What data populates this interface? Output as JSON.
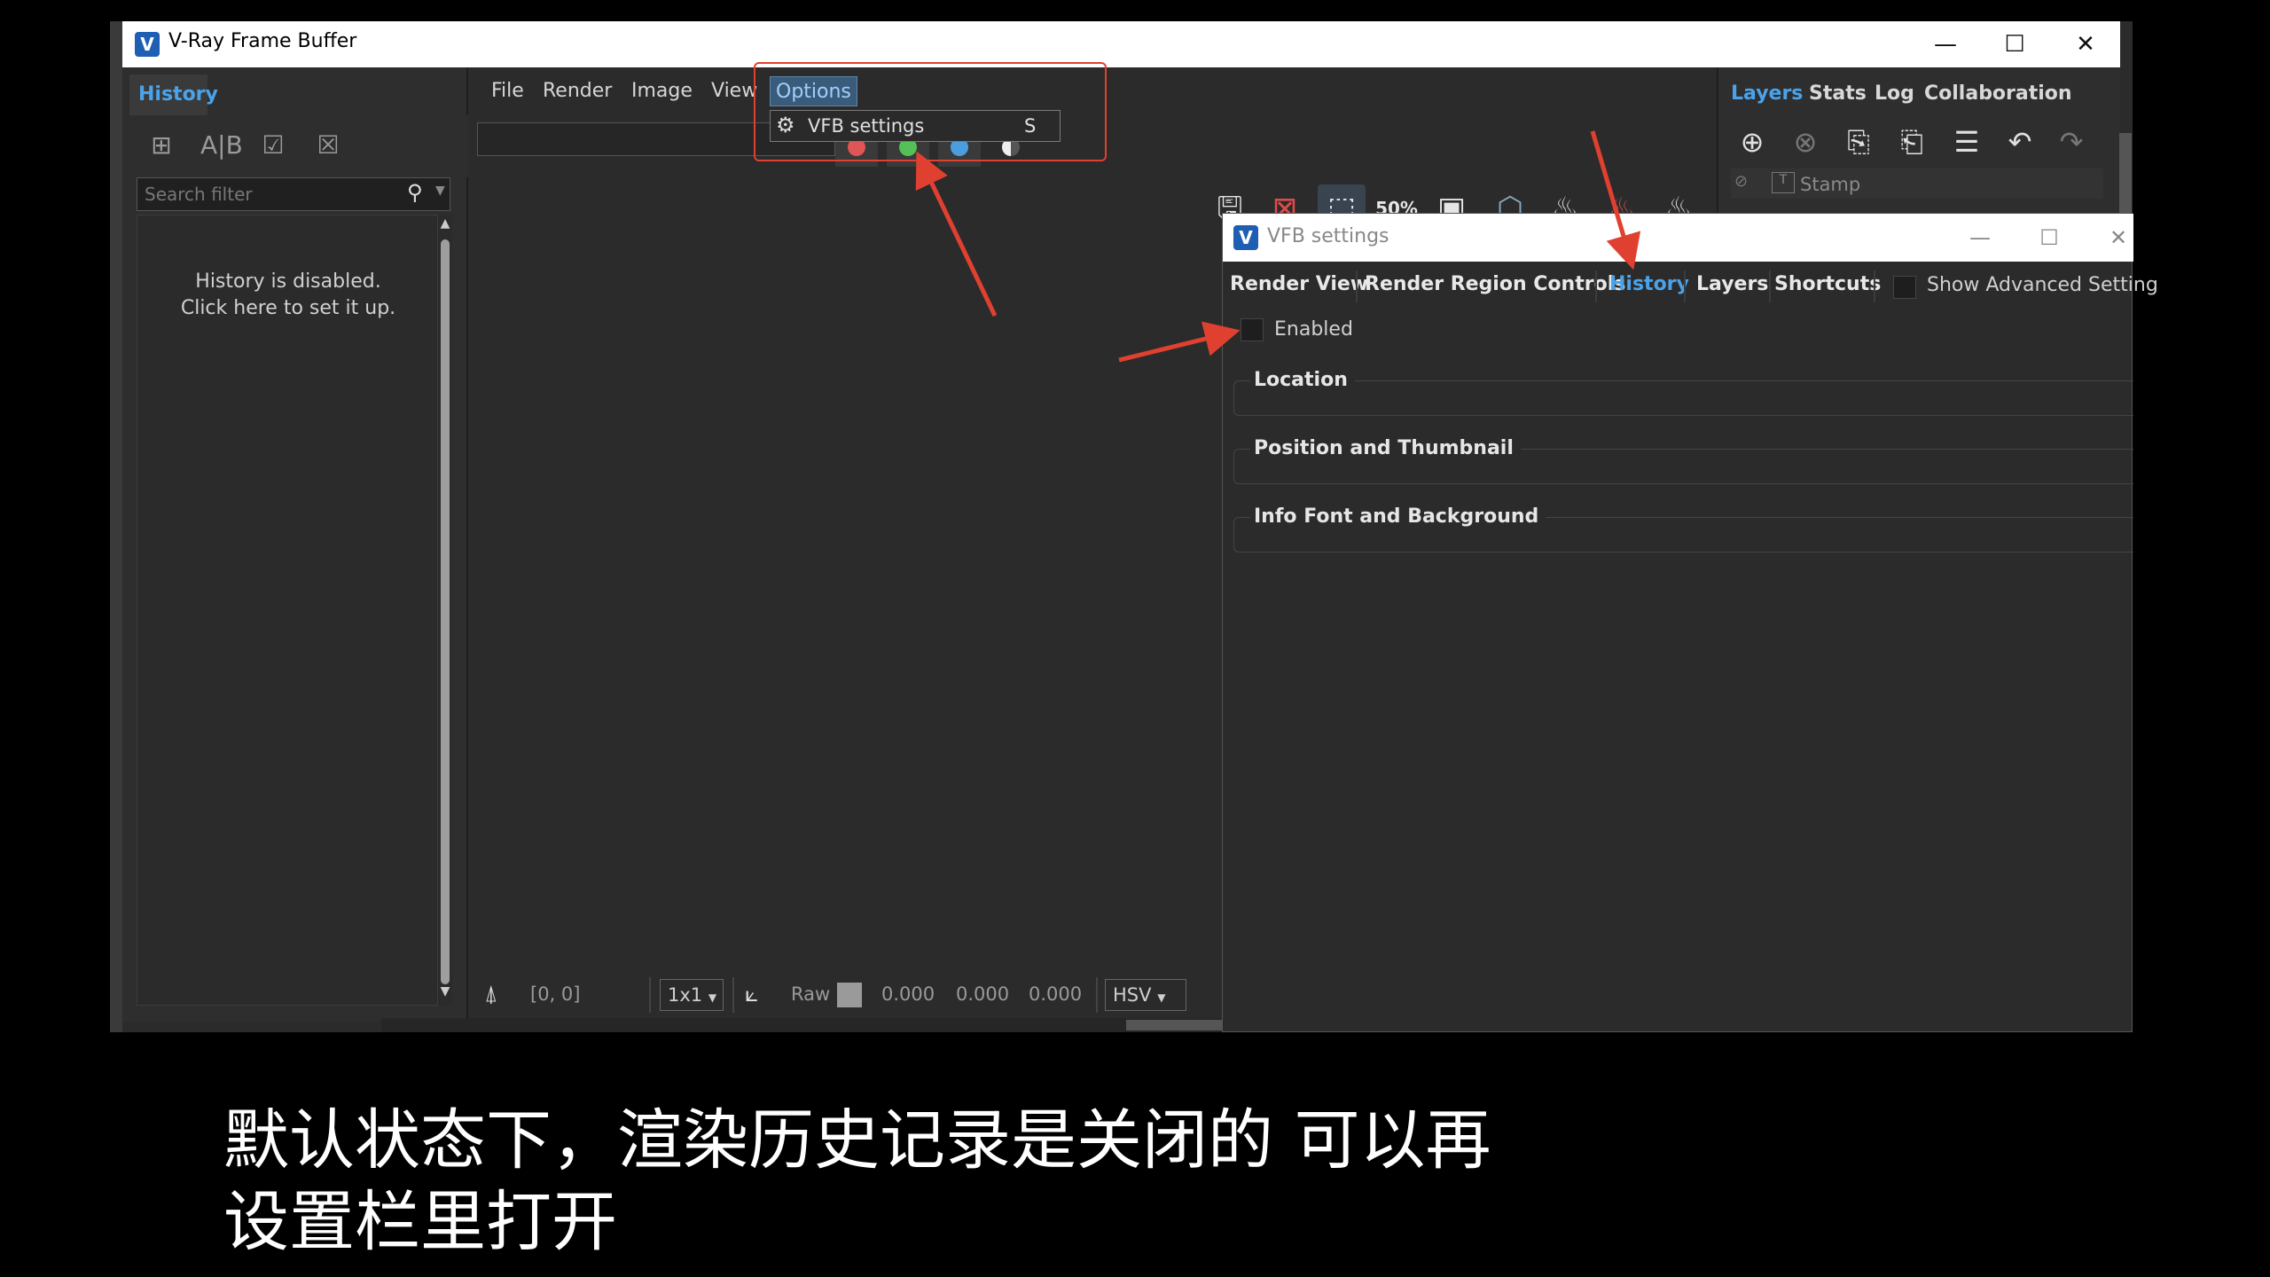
{
  "window": {
    "title": "V-Ray Frame Buffer",
    "app_icon": "vray-logo-icon",
    "minimize": "—",
    "maximize": "☐",
    "close": "✕"
  },
  "history_panel": {
    "tab": "History",
    "search_placeholder": "Search filter",
    "message_line1": "History is disabled.",
    "message_line2": "Click here to set it up."
  },
  "menu": {
    "file": "File",
    "render": "Render",
    "image": "Image",
    "view": "View",
    "options": "Options"
  },
  "options_menu": {
    "items": [
      {
        "label": "VFB settings",
        "shortcut": "S",
        "icon": "gear-icon"
      }
    ]
  },
  "status": {
    "coords": "[0, 0]",
    "sampler": "1x1",
    "mode": "Raw",
    "r": "0.000",
    "g": "0.000",
    "b": "0.000",
    "color_space": "HSV"
  },
  "right_panel": {
    "tabs": [
      "Layers",
      "Stats",
      "Log",
      "Collaboration"
    ],
    "layer_label": "Stamp"
  },
  "settings_dialog": {
    "title": "VFB settings",
    "tabs": [
      "Render View",
      "Render Region Controls",
      "History",
      "Layers",
      "Shortcuts"
    ],
    "active_tab": "History",
    "advanced_label": "Show Advanced Setting",
    "enabled_label": "Enabled",
    "groups": [
      "Location",
      "Position and Thumbnail",
      "Info Font and Background"
    ]
  },
  "subtitle": {
    "line1": "默认状态下，渲染历史记录是关闭的 可以再",
    "line2": "设置栏里打开"
  },
  "colors": {
    "accent": "#4aa3ea",
    "annotation": "#e04030",
    "background": "#2b2b2b"
  }
}
